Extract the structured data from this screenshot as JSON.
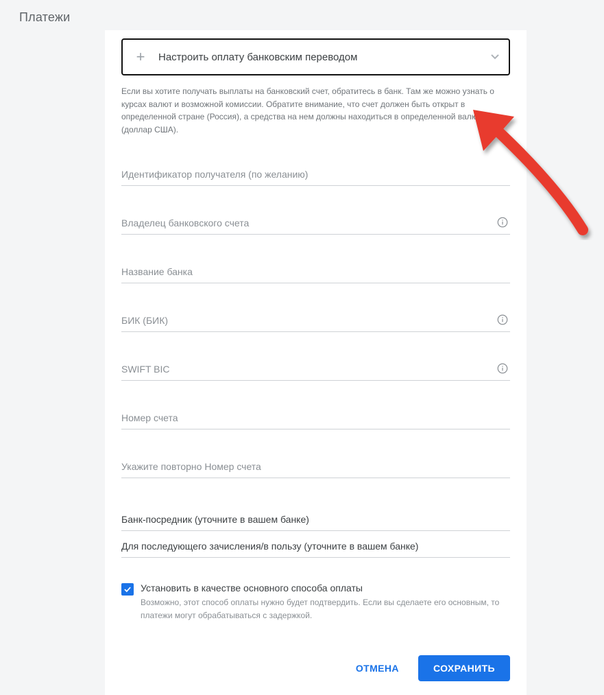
{
  "page": {
    "title": "Платежи"
  },
  "collapser": {
    "label": "Настроить оплату банковским переводом"
  },
  "info_text": "Если вы хотите получать выплаты на банковский счет, обратитесь в банк. Там же можно узнать о курсах валют и возможной комиссии. Обратите внимание, что счет должен быть открыт в определенной стране (Россия), а средства на нем должны находиться в определенной валюте (доллар США).",
  "fields": {
    "beneficiary_id": {
      "label": "Идентификатор получателя (по желанию)"
    },
    "account_owner": {
      "label": "Владелец банковского счета"
    },
    "bank_name": {
      "label": "Название банка"
    },
    "bik": {
      "label": "БИК (БИК)"
    },
    "swift": {
      "label": "SWIFT BIC"
    },
    "account_number": {
      "label": "Номер счета"
    },
    "account_number_repeat": {
      "label": "Укажите повторно Номер счета"
    }
  },
  "subfields": {
    "intermediary_bank": "Банк-посредник (уточните в вашем банке)",
    "for_credit_to": "Для последующего зачисления/в пользу (уточните в вашем банке)"
  },
  "checkbox": {
    "label": "Установить в качестве основного способа оплаты",
    "help": "Возможно, этот способ оплаты нужно будет подтвердить. Если вы сделаете его основным, то платежи могут обрабатываться с задержкой."
  },
  "actions": {
    "cancel": "ОТМЕНА",
    "save": "СОХРАНИТЬ"
  }
}
